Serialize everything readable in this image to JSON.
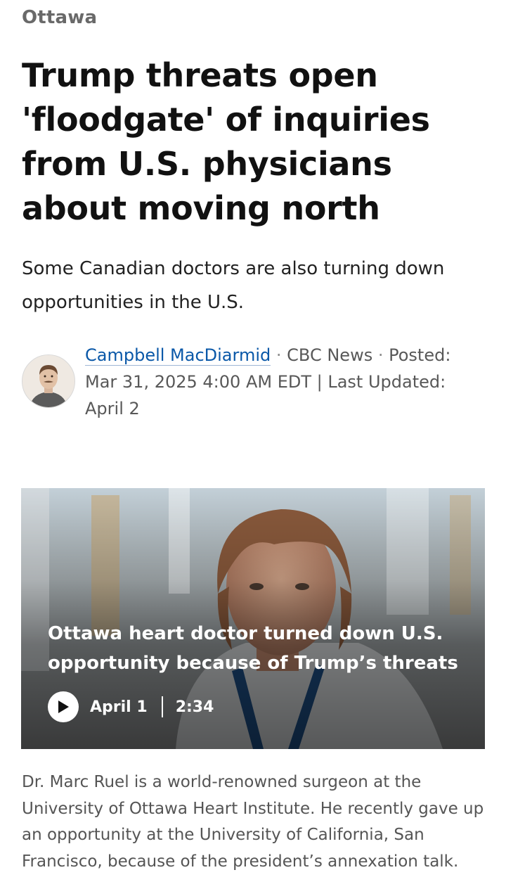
{
  "section": "Ottawa",
  "headline": "Trump threats open 'floodgate' of inquiries from U.S. physicians about moving north",
  "deck": "Some Canadian doctors are also turning down opportunities in the U.S.",
  "byline": {
    "author": "Campbell MacDiarmid",
    "separator": "·",
    "outlet": "CBC News",
    "posted": "Posted: Mar 31, 2025 4:00 AM EDT | Last Updated: April 2"
  },
  "video": {
    "title": "Ottawa heart doctor turned down U.S. opportunity because of Trump’s threats",
    "date": "April 1",
    "duration": "2:34",
    "play_icon": "play-icon"
  },
  "caption": "Dr. Marc Ruel is a world-renowned surgeon at the University of Ottawa Heart Institute. He recently gave up an opportunity at the University of California, San Francisco, because of the president’s annexation talk.",
  "colors": {
    "link": "#0a58a8",
    "section_label": "#696969",
    "caption_text": "#555555"
  }
}
